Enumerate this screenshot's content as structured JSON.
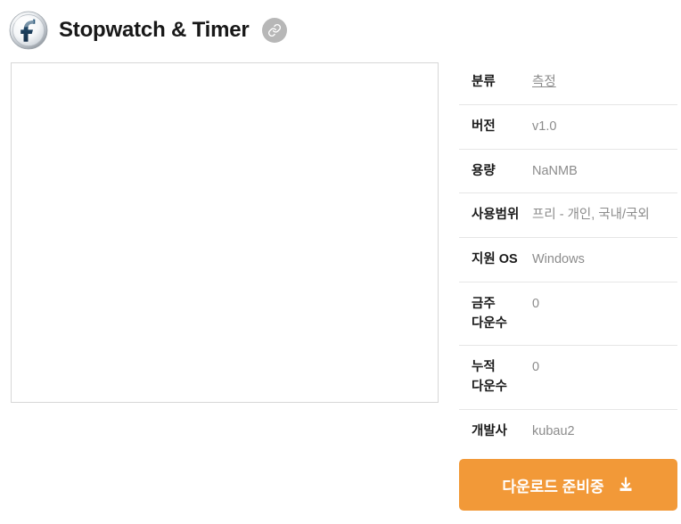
{
  "header": {
    "app_title": "Stopwatch & Timer",
    "app_icon": "flash-icon",
    "link_icon": "link-icon"
  },
  "preview": {
    "name": "screenshot-preview-area"
  },
  "info": {
    "rows": [
      {
        "label": "분류",
        "value": "측정",
        "is_link": true
      },
      {
        "label": "버전",
        "value": "v1.0",
        "is_link": false
      },
      {
        "label": "용량",
        "value": "NaNMB",
        "is_link": false
      },
      {
        "label": "사용범위",
        "value": "프리 - 개인, 국내/국외",
        "is_link": false
      },
      {
        "label": "지원 OS",
        "value": "Windows",
        "is_link": false
      },
      {
        "label": "금주 다운수",
        "value": "0",
        "is_link": false
      },
      {
        "label": "누적 다운수",
        "value": "0",
        "is_link": false
      },
      {
        "label": "개발사",
        "value": "kubau2",
        "is_link": false
      }
    ]
  },
  "download": {
    "label": "다운로드 준비중",
    "icon": "download-icon",
    "color": "#f29938"
  }
}
